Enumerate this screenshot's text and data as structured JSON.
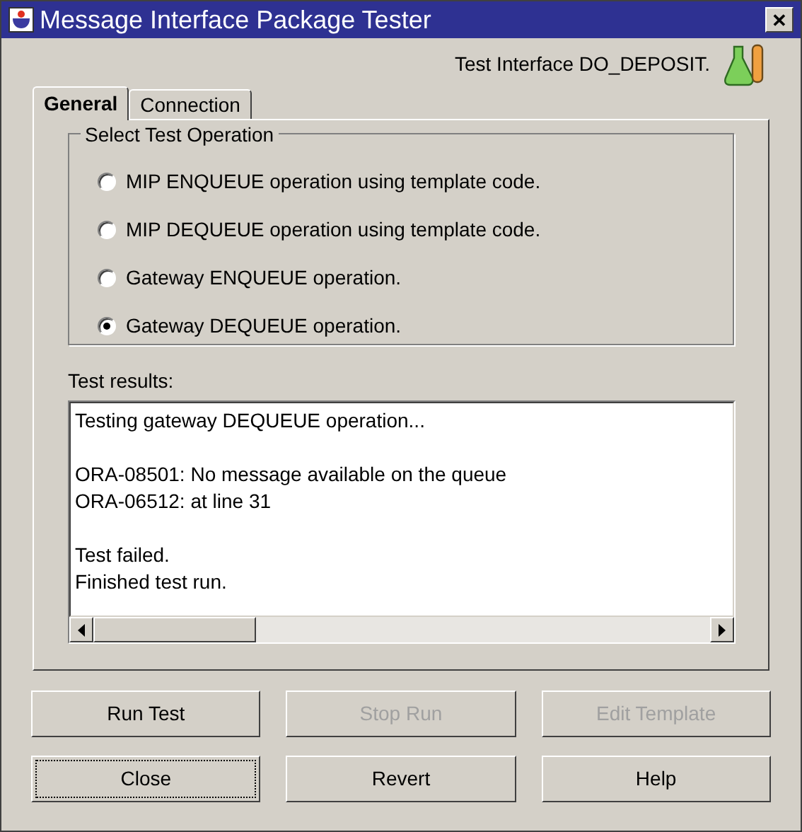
{
  "window": {
    "title": "Message Interface Package Tester",
    "close_button": "✕"
  },
  "header": {
    "text": "Test Interface DO_DEPOSIT."
  },
  "tabs": [
    {
      "label": "General",
      "selected": true
    },
    {
      "label": "Connection",
      "selected": false
    }
  ],
  "operation_group": {
    "title": "Select Test Operation",
    "options": [
      {
        "label": "MIP ENQUEUE operation using template code.",
        "selected": false
      },
      {
        "label": "MIP DEQUEUE operation using template code.",
        "selected": false
      },
      {
        "label": "Gateway ENQUEUE operation.",
        "selected": false
      },
      {
        "label": "Gateway DEQUEUE operation.",
        "selected": true
      }
    ]
  },
  "results": {
    "label": "Test results:",
    "paragraphs": [
      [
        "Testing gateway DEQUEUE operation..."
      ],
      [
        "ORA-08501: No message available on the queue",
        "ORA-06512: at line 31"
      ],
      [
        "Test failed.",
        "Finished test run."
      ]
    ]
  },
  "buttons": [
    {
      "label": "Run Test",
      "disabled": false,
      "focused": false
    },
    {
      "label": "Stop Run",
      "disabled": true,
      "focused": false
    },
    {
      "label": "Edit Template",
      "disabled": true,
      "focused": false
    },
    {
      "label": "Close",
      "disabled": false,
      "focused": true
    },
    {
      "label": "Revert",
      "disabled": false,
      "focused": false
    },
    {
      "label": "Help",
      "disabled": false,
      "focused": false
    }
  ]
}
